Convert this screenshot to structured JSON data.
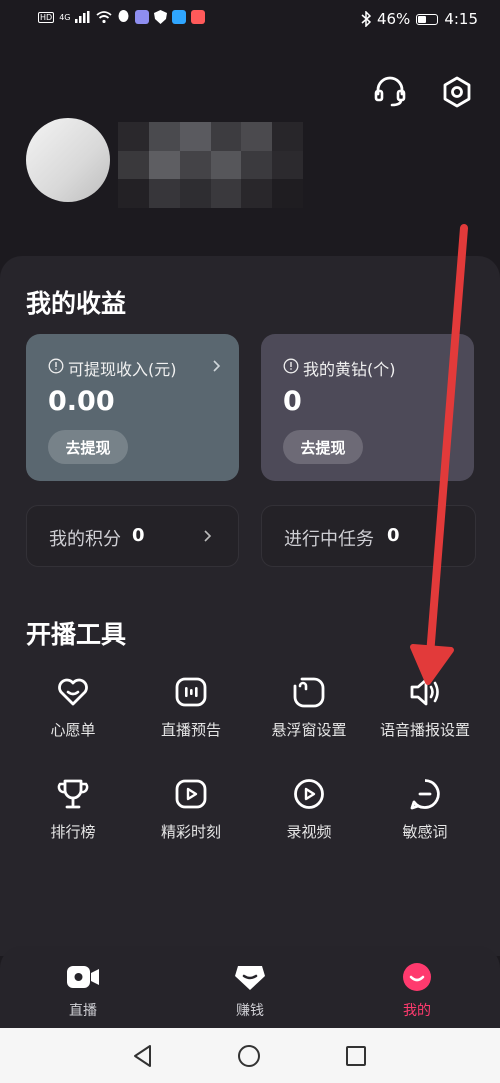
{
  "status_bar": {
    "network_label": "HD",
    "signal_label": "4G",
    "battery_percent": "46%",
    "time": "4:15"
  },
  "header": {
    "icons": [
      "headset-icon",
      "settings-hexagon-icon"
    ]
  },
  "earnings": {
    "title": "我的收益",
    "cash_card": {
      "label": "可提现收入(元)",
      "value": "0.00",
      "button": "去提现"
    },
    "diamond_card": {
      "label": "我的黄钻(个)",
      "value": "0",
      "button": "去提现"
    },
    "points": {
      "label": "我的积分",
      "value": "0"
    },
    "tasks": {
      "label": "进行中任务",
      "value": "0"
    }
  },
  "tools": {
    "title": "开播工具",
    "items": [
      {
        "label": "心愿单",
        "icon": "heart-icon"
      },
      {
        "label": "直播预告",
        "icon": "live-preview-icon"
      },
      {
        "label": "悬浮窗设置",
        "icon": "floating-window-icon"
      },
      {
        "label": "语音播报设置",
        "icon": "speaker-icon"
      },
      {
        "label": "排行榜",
        "icon": "trophy-icon"
      },
      {
        "label": "精彩时刻",
        "icon": "highlight-play-icon"
      },
      {
        "label": "录视频",
        "icon": "record-video-icon"
      },
      {
        "label": "敏感词",
        "icon": "sensitive-word-icon"
      }
    ]
  },
  "bottom_nav": {
    "items": [
      {
        "label": "直播",
        "icon": "live-camera-icon"
      },
      {
        "label": "赚钱",
        "icon": "earn-icon"
      },
      {
        "label": "我的",
        "icon": "profile-icon",
        "active": true
      }
    ]
  },
  "colors": {
    "background": "#1c1a1f",
    "panel": "#27252b",
    "accent_pink": "#ff3a6e",
    "annotation_red": "#e23a3a"
  }
}
